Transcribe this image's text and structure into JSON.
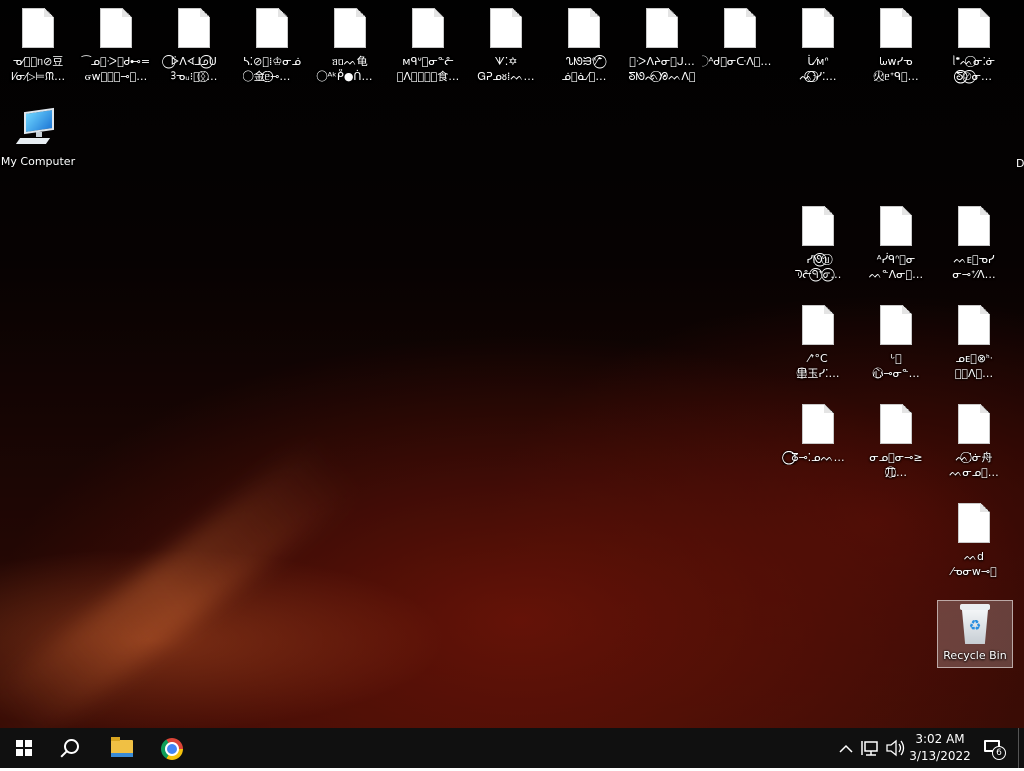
{
  "desktop": {
    "top_row_icons": [
      {
        "line1": "ᓀ⁄ᡁ⃝ᥒ⊘豆",
        "line2": "ⅼ⁄ᓂ⁄▷⊨ᙏ…"
      },
      {
        "line1": "⁀ᓄ⃝ᑀᘏᏧ⊷=",
        "line2": "ᏻᴡ⃝⃝⃝⊸⃝…"
      },
      {
        "line1": "⃝ᢰᐱᗏ⅃ᓄ⃝ᑌ",
        "line2": "ᢃᓀᵤ⁝⃝ᛝ⃝…"
      },
      {
        "line1": "ᓴ⁚⊘⃝⁞♔ᓂᓅ",
        "line2": "⃝⃝金ᥱ⃝⃝⊸…"
      },
      {
        "line1": "ᥑᥝᨓ龟",
        "line2": "⃝⃝ᴬᵏᑬ●ᑏ…"
      },
      {
        "line1": "ᴍᑫᐡ⃝ᓂᓐᓔ",
        "line2": "⃝ᐱ⃝ᗣ⃝⃝食…"
      },
      {
        "line1": "ᗐ⁚✡",
        "line2": "Ꮐᕈᓄᴕ⁞ᨓ…"
      },
      {
        "line1": "ᔐᘚᙣᐢ⁄ᐩ⃝",
        "line2": "ᓅ⃝ᓈ⁄⃝…"
      },
      {
        "line1": "⃝ᑀᐱᔨᓂ⃝ᒍ…",
        "line2": "ᘕᘚᨒ⃝ᘠᨓᐱ⃝"
      },
      {
        "line1": "⃝ᴬᑯ⃝ᓂᑢᐱ⃝…",
        "line2": ""
      },
      {
        "line1": "ᒑ⁄ᴍᐢ",
        "line2": "ᨓ⃝⃝⁝⃝ᓯ⁚…"
      },
      {
        "line1": "ᘈᴡᓯᓀ",
        "line2": "火⃝ᥱᐩᑫ⃝…"
      },
      {
        "line1": "ᥣᙿᨓ⃝ᓂ⁚ᓃ",
        "line2": "ᘕ⃝⃝⊘⃝ᓂ…"
      }
    ],
    "my_computer_label": "My Computer",
    "right_icons": [
      {
        "line1": "ᓯᘚ⃝ᥔ⃝",
        "line2": "ᘅᓔᑫ⃝ᐩᓂ⃝…"
      },
      {
        "line1": "ᴬᓰᑫᐢ⃝ᓂ",
        "line2": "ᨓᓐᐱᓂ⃝…"
      },
      {
        "line1": "ᨓᴇ⃝ᓀᓯ",
        "line2": "ᓂ⊸ᐩ⁄ᐱ…"
      },
      {
        "line1": "⁄ᐩ°C",
        "line2": "里⃝玉ᓯ⁚…"
      },
      {
        "line1": "ᒡ⃝",
        "line2": "心⃝⊸ᓂᓐ…"
      },
      {
        "line1": "ᓄᴇ⃝⊗ᑋᐧ",
        "line2": "⃝⃝ᐱ⃝…"
      },
      {
        "line1": "⃝⃝ᘔ⊸⁚ᓄᨓ…",
        "line2": ""
      },
      {
        "line1": "ᓂᓄ⃝ᓂ⊸≥",
        "line2": "兀⃝⃝…"
      },
      {
        "line1": "ᨓ⃝⁚ᓃ舟",
        "line2": "ᨓᓂᓄ⃝…"
      },
      {
        "line1": "ᨓd",
        "line2": "⁄ᓀᓂᴡ⊸⃝"
      }
    ],
    "recycle_bin_label": "Recycle Bin",
    "edge_fragment": "D"
  },
  "taskbar": {
    "clock_time": "3:02 AM",
    "clock_date": "3/13/2022",
    "notification_count": "6"
  }
}
